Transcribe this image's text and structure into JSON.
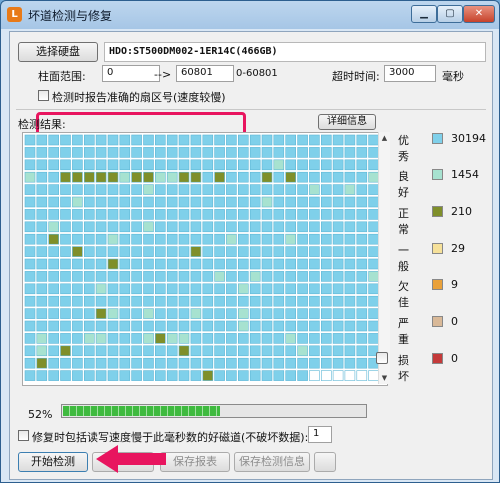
{
  "window": {
    "title": "坏道检测与修复",
    "app_icon": "L"
  },
  "disk": {
    "select_button": "选择硬盘",
    "name": "HDO:ST500DM002-1ER14C(466GB)"
  },
  "range": {
    "label": "柱面范围:",
    "start": "0",
    "arrow": "-->",
    "end": "60801",
    "hint": "0-60801"
  },
  "timeout": {
    "label": "超时时间:",
    "value": "3000",
    "unit": "毫秒"
  },
  "report_sector": {
    "label": "检测时报告准确的扇区号(速度较慢)",
    "checked": false
  },
  "results": {
    "label": "检测结果:",
    "details_button": "详细信息"
  },
  "legend": [
    {
      "label": "优秀",
      "count": "30194",
      "color": "#7fd0ea"
    },
    {
      "label": "良好",
      "count": "1454",
      "color": "#a7e2d0"
    },
    {
      "label": "正常",
      "count": "210",
      "color": "#7f8f2a"
    },
    {
      "label": "一般",
      "count": "29",
      "color": "#f6e19a"
    },
    {
      "label": "欠佳",
      "count": "9",
      "color": "#e9a13a"
    },
    {
      "label": "严重",
      "count": "0",
      "color": "#d9b998"
    },
    {
      "label": "损坏",
      "count": "0",
      "color": "#c43a3a"
    }
  ],
  "progress": {
    "percent_text": "52%",
    "fraction": 0.52
  },
  "repair_option": {
    "label": "修复时包括读写速度慢于此毫秒数的好磁道(不破坏数据):",
    "value": "1"
  },
  "actions": {
    "start": "开始检测",
    "save_report": "保存报表",
    "save_info": "保存检测信息"
  },
  "colors": {
    "excellent": "#7fd0ea",
    "good": "#a7e2d0",
    "normal": "#7f8f2a",
    "highlight": "#e8155f",
    "progress": "#3fba3f"
  }
}
